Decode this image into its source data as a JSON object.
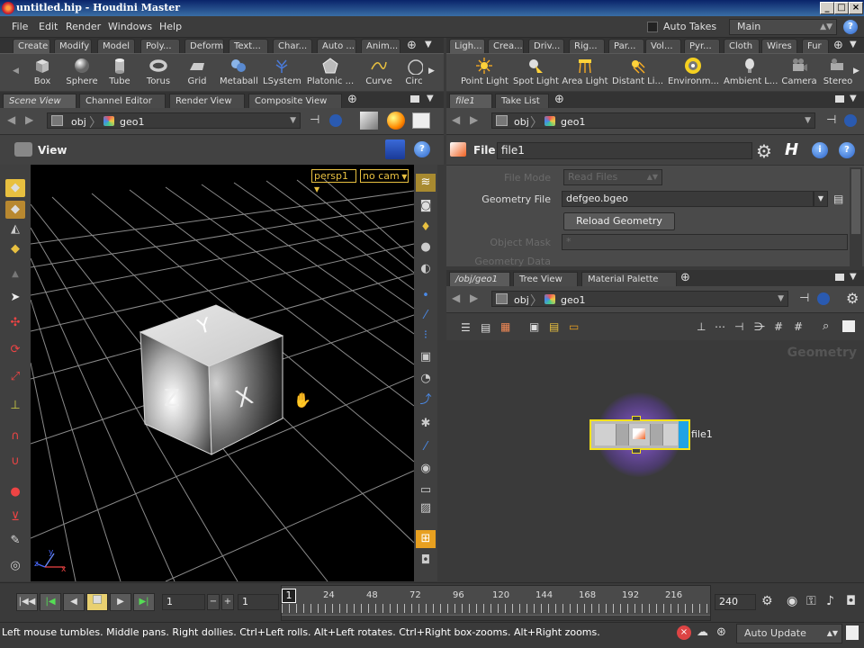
{
  "window": {
    "title": "untitled.hip - Houdini Master"
  },
  "menubar": {
    "items": [
      "File",
      "Edit",
      "Render",
      "Windows",
      "Help"
    ],
    "auto_takes_label": "Auto Takes",
    "desktop_value": "Main"
  },
  "shelf_left": {
    "tabs": [
      "Create",
      "Modify",
      "Model",
      "Poly...",
      "Deform",
      "Text...",
      "Char...",
      "Auto ...",
      "Anim..."
    ],
    "tools": [
      "Box",
      "Sphere",
      "Tube",
      "Torus",
      "Grid",
      "Metaball",
      "LSystem",
      "Platonic ...",
      "Curve",
      "Circ"
    ]
  },
  "shelf_right": {
    "tabs": [
      "Ligh...",
      "Crea...",
      "Driv...",
      "Rig...",
      "Par...",
      "Vol...",
      "Pyr...",
      "Cloth",
      "Wires",
      "Fur"
    ],
    "tools": [
      "Point Light",
      "Spot Light",
      "Area Light",
      "Distant Li...",
      "Environm...",
      "Ambient L...",
      "Camera",
      "Stereo"
    ]
  },
  "scene_pane": {
    "tabs": [
      "Scene View",
      "Channel Editor",
      "Render View",
      "Composite View"
    ],
    "path": [
      "obj",
      "geo1"
    ],
    "view_label": "View",
    "camera_menu": "persp1",
    "cam_menu": "no cam",
    "axis_labels": [
      "y",
      "z",
      "x"
    ]
  },
  "param_pane": {
    "tabs": [
      "file1",
      "Take List"
    ],
    "path": [
      "obj",
      "geo1"
    ],
    "node_type": "File",
    "node_name": "file1",
    "parms": {
      "file_mode_label": "File Mode",
      "file_mode_value": "Read Files",
      "geometry_file_label": "Geometry File",
      "geometry_file_value": "defgeo.bgeo",
      "reload_button": "Reload Geometry",
      "object_mask_label": "Object Mask",
      "object_mask_value": "*",
      "geometry_data_path_label": "Geometry Data Path"
    }
  },
  "network_pane": {
    "tabs": [
      "/obj/geo1",
      "Tree View",
      "Material Palette"
    ],
    "path": [
      "obj",
      "geo1"
    ],
    "context_label": "Geometry",
    "node_label": "file1"
  },
  "timeline": {
    "current_frame": "1",
    "start_frame": "1",
    "ticks": [
      "1",
      "24",
      "48",
      "72",
      "96",
      "120",
      "144",
      "168",
      "192",
      "216"
    ],
    "end_frame": "240"
  },
  "statusbar": {
    "message": "Left mouse tumbles. Middle pans. Right dollies. Ctrl+Left rolls. Alt+Left rotates. Ctrl+Right box-zooms. Alt+Right zooms.",
    "update_mode": "Auto Update"
  },
  "colors": {
    "node_outline": "#f5e21a",
    "node_flag_blue": "#1fa3e6",
    "viewport_bg": "#000000",
    "grid_line": "#9a9a9a"
  }
}
